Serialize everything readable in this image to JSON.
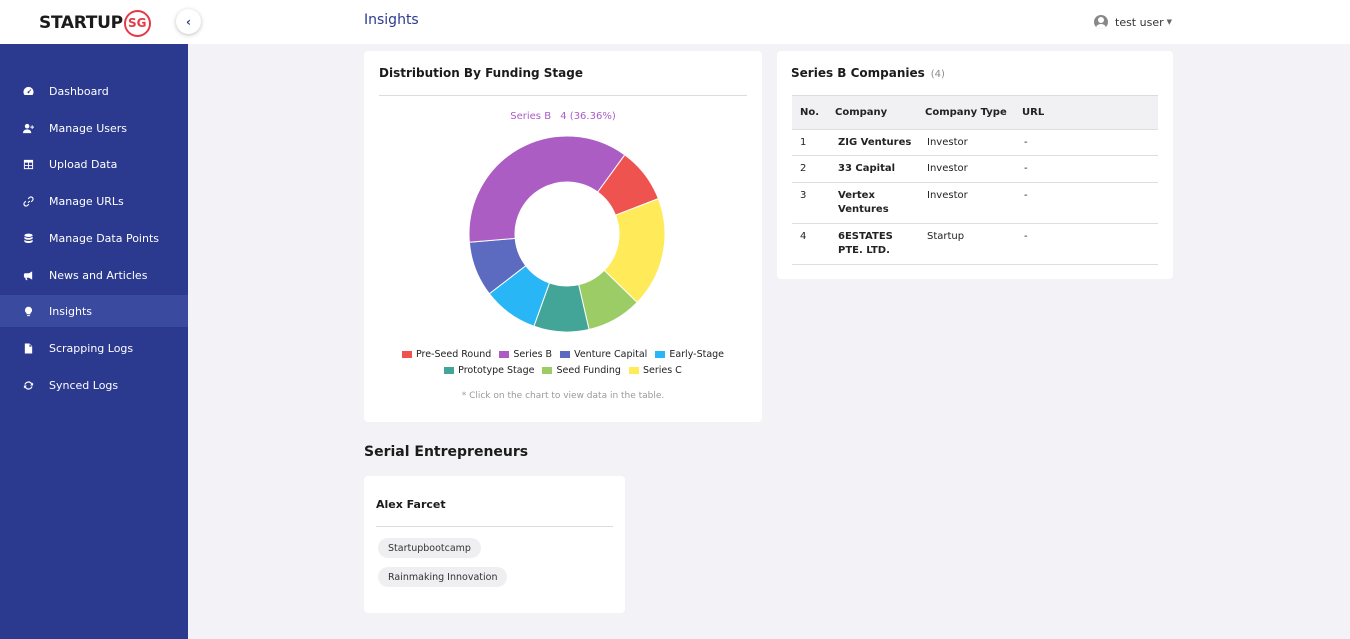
{
  "header": {
    "logo_text": "STARTUP",
    "logo_badge": "SG",
    "collapse_icon": "chevron-left-icon",
    "page_title": "Insights",
    "user_name": "test user"
  },
  "sidebar": {
    "items": [
      {
        "label": "Dashboard",
        "icon": "gauge-icon"
      },
      {
        "label": "Manage Users",
        "icon": "user-plus-icon"
      },
      {
        "label": "Upload Data",
        "icon": "table-icon"
      },
      {
        "label": "Manage URLs",
        "icon": "link-icon"
      },
      {
        "label": "Manage Data Points",
        "icon": "database-icon"
      },
      {
        "label": "News and Articles",
        "icon": "megaphone-icon"
      },
      {
        "label": "Insights",
        "icon": "lightbulb-icon",
        "active": true
      },
      {
        "label": "Scrapping Logs",
        "icon": "file-icon"
      },
      {
        "label": "Synced Logs",
        "icon": "sync-icon"
      }
    ]
  },
  "funding_card": {
    "title": "Distribution By Funding Stage",
    "tooltip_label": "Series B",
    "tooltip_value": "4 (36.36%)",
    "note": "* Click on the chart to view data in the table."
  },
  "chart_data": {
    "type": "pie",
    "donut": true,
    "categories": [
      "Pre-Seed Round",
      "Series B",
      "Venture Capital",
      "Early-Stage",
      "Prototype Stage",
      "Seed Funding",
      "Series C"
    ],
    "values": [
      1,
      4,
      1,
      1,
      1,
      1,
      2
    ],
    "colors": [
      "#ef5350",
      "#ab5dc4",
      "#5c6bc0",
      "#29b6f6",
      "#43a597",
      "#9ccc65",
      "#ffeb5a"
    ],
    "legend_position": "bottom",
    "highlighted": "Series B"
  },
  "series_b_card": {
    "title": "Series B Companies",
    "count": "(4)",
    "columns": [
      "No.",
      "Company",
      "Company Type",
      "URL"
    ],
    "rows": [
      {
        "no": "1",
        "company": "ZIG Ventures",
        "type": "Investor",
        "url": "-"
      },
      {
        "no": "2",
        "company": "33 Capital",
        "type": "Investor",
        "url": "-"
      },
      {
        "no": "3",
        "company": "Vertex Ventures",
        "type": "Investor",
        "url": "-"
      },
      {
        "no": "4",
        "company": "6ESTATES PTE. LTD.",
        "type": "Startup",
        "url": "-"
      }
    ]
  },
  "serial_entrepreneurs": {
    "title": "Serial Entrepreneurs",
    "people": [
      {
        "name": "Alex Farcet",
        "companies": [
          "Startupbootcamp",
          "Rainmaking Innovation"
        ]
      }
    ]
  }
}
